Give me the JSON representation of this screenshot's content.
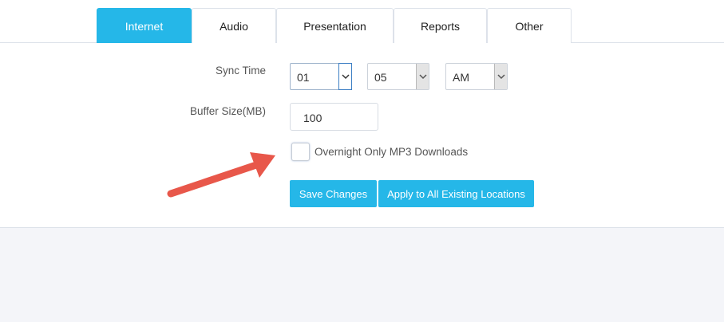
{
  "tabs": [
    {
      "label": "Internet",
      "active": true
    },
    {
      "label": "Audio",
      "active": false
    },
    {
      "label": "Presentation",
      "active": false
    },
    {
      "label": "Reports",
      "active": false
    },
    {
      "label": "Other",
      "active": false
    }
  ],
  "form": {
    "sync_time": {
      "label": "Sync Time",
      "hour": "01",
      "minute": "05",
      "period": "AM"
    },
    "buffer_size": {
      "label": "Buffer Size(MB)",
      "value": "100"
    },
    "overnight_mp3": {
      "label": "Overnight Only MP3 Downloads",
      "checked": false
    },
    "buttons": {
      "save": "Save Changes",
      "apply_all": "Apply to All Existing Locations"
    }
  },
  "colors": {
    "accent": "#25b7e8",
    "annotation_arrow": "#e8574a",
    "page_background": "#f4f5f9"
  },
  "icons": {
    "dropdown": "chevron-down-icon",
    "annotation": "pointer-arrow-icon"
  }
}
